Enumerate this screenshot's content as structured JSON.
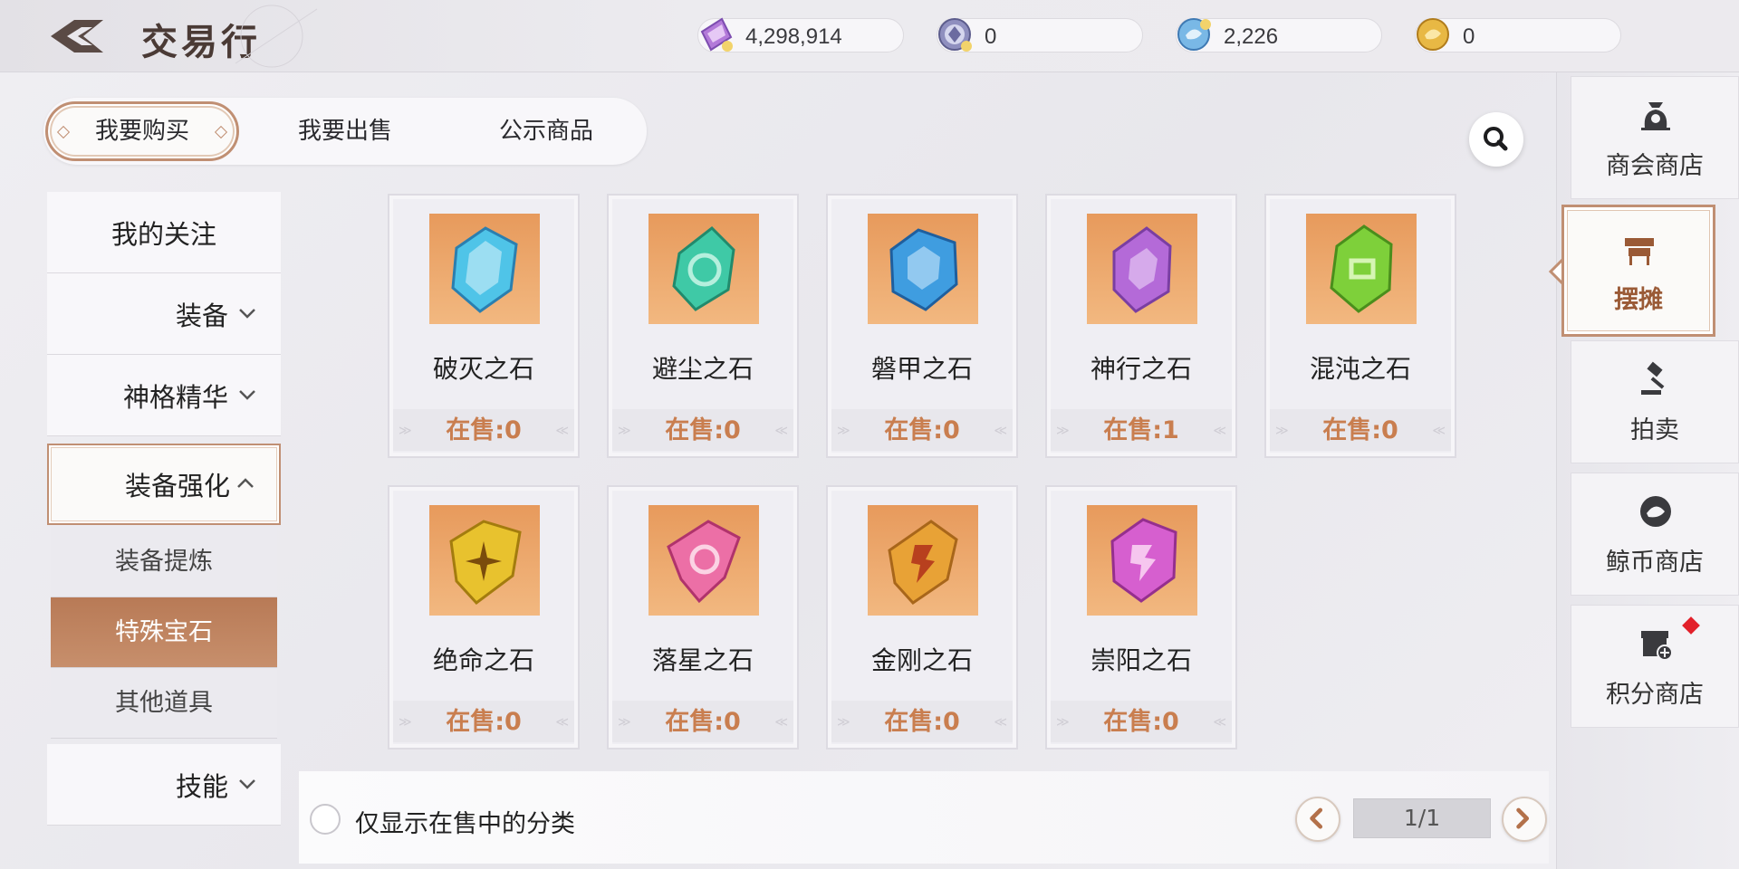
{
  "header": {
    "title": "交易行",
    "back_icon": "back-arrow-icon"
  },
  "currencies": [
    {
      "icon": "purple-crystal-icon",
      "value": "4,298,914"
    },
    {
      "icon": "silver-coin-icon",
      "value": "0"
    },
    {
      "icon": "blue-whale-coin-icon",
      "value": "2,226"
    },
    {
      "icon": "gold-coin-icon",
      "value": "0"
    }
  ],
  "tabs": [
    {
      "label": "我要购买",
      "active": true
    },
    {
      "label": "我要出售",
      "active": false
    },
    {
      "label": "公示商品",
      "active": false
    }
  ],
  "categories": {
    "favorites": "我的关注",
    "equipment": "装备",
    "divine_essence": "神格精华",
    "equip_enhance": "装备强化",
    "sub_refine": "装备提炼",
    "sub_gems": "特殊宝石",
    "sub_other": "其他道具",
    "skills": "技能"
  },
  "items": [
    {
      "name": "破灭之石",
      "stock": "在售:0",
      "color": "#4fc4e8"
    },
    {
      "name": "避尘之石",
      "stock": "在售:0",
      "color": "#3fc9a6"
    },
    {
      "name": "磐甲之石",
      "stock": "在售:0",
      "color": "#3f9de0"
    },
    {
      "name": "神行之石",
      "stock": "在售:1",
      "color": "#b46ad8"
    },
    {
      "name": "混沌之石",
      "stock": "在售:0",
      "color": "#7ed03a"
    },
    {
      "name": "绝命之石",
      "stock": "在售:0",
      "color": "#e8c22e"
    },
    {
      "name": "落星之石",
      "stock": "在售:0",
      "color": "#ec6fa6"
    },
    {
      "name": "金刚之石",
      "stock": "在售:0",
      "color": "#e8a236"
    },
    {
      "name": "崇阳之石",
      "stock": "在售:0",
      "color": "#d65fcf"
    }
  ],
  "footer": {
    "filter_label": "仅显示在售中的分类",
    "page": "1/1"
  },
  "right_nav": [
    {
      "label": "商会商店",
      "icon": "money-bag-icon"
    },
    {
      "label": "摆摊",
      "icon": "market-stall-icon",
      "active": true
    },
    {
      "label": "拍卖",
      "icon": "gavel-icon"
    },
    {
      "label": "鲸币商店",
      "icon": "whale-coin-icon"
    },
    {
      "label": "积分商店",
      "icon": "shop-plus-icon",
      "badge": true
    }
  ],
  "colors": {
    "accent": "#c08f73",
    "stock_text": "#c97e4f",
    "active_sub": "#c08560",
    "badge": "#e2202a"
  }
}
